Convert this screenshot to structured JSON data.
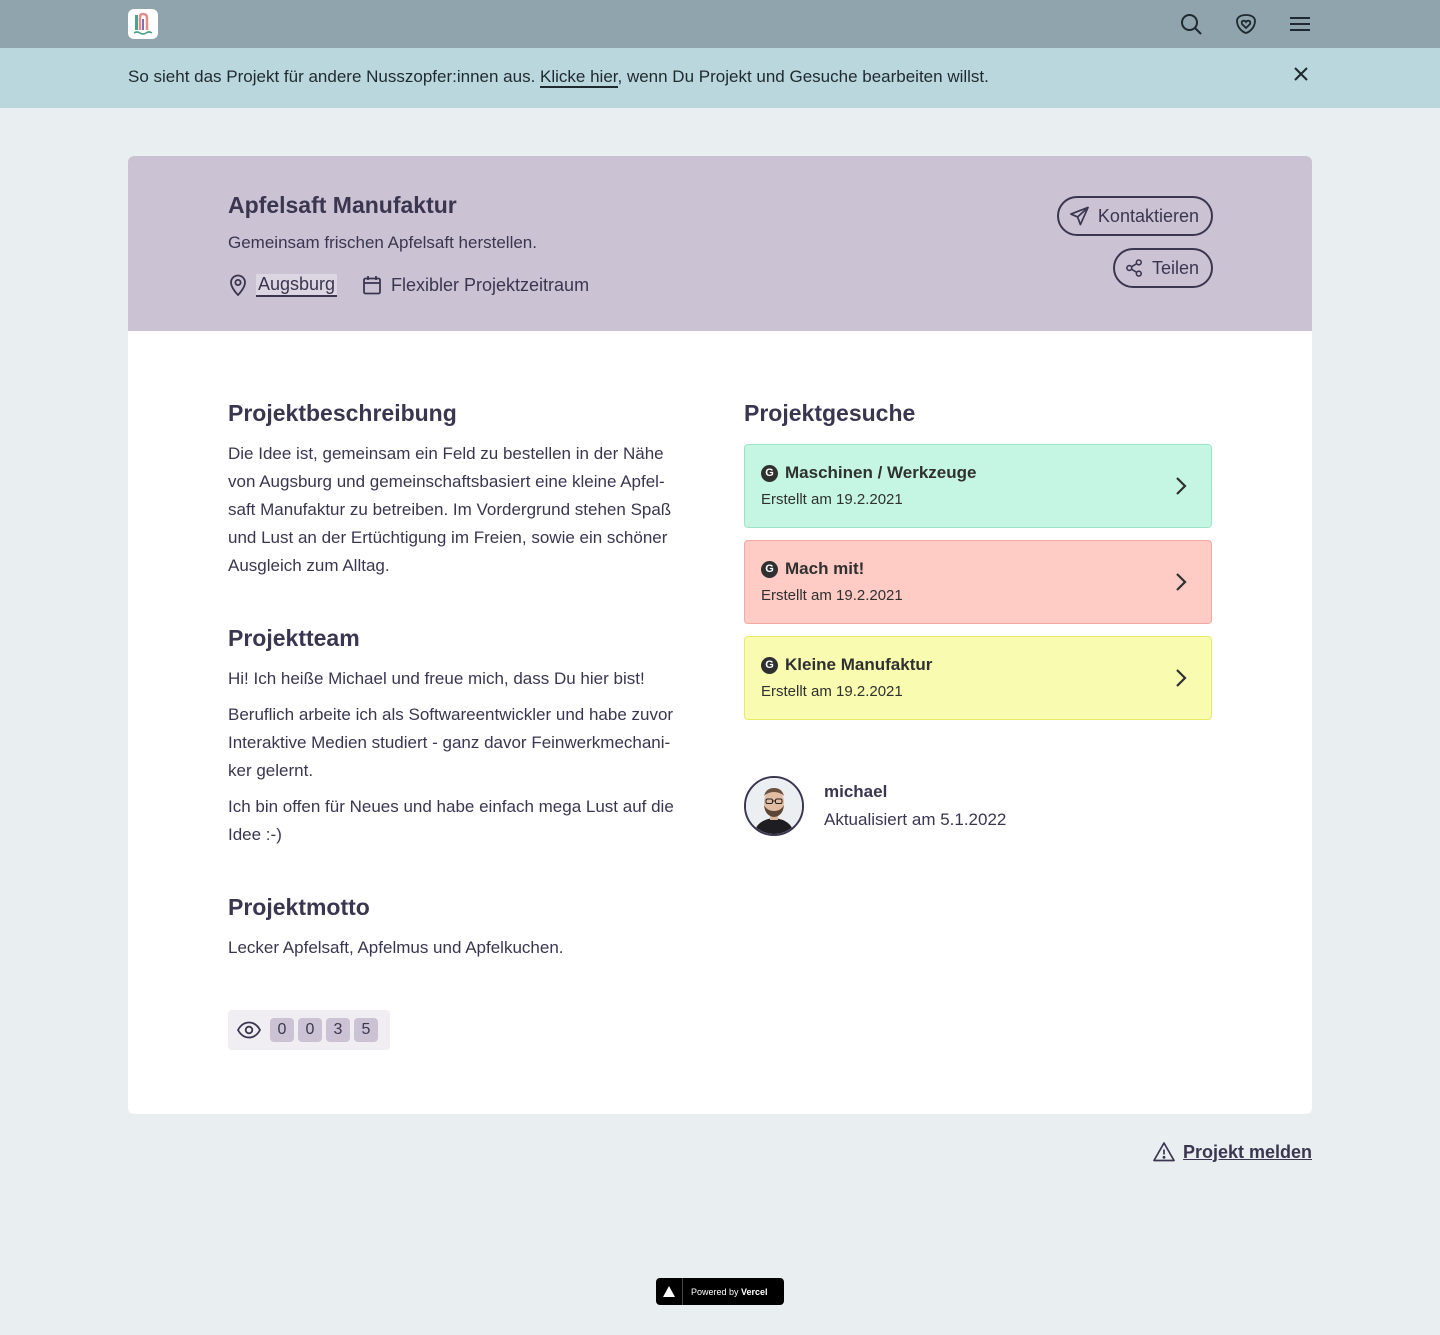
{
  "banner": {
    "text_before": "So sieht das Projekt für andere Nusszopfer:innen aus. ",
    "link": "Klicke hier",
    "text_after": ", wenn Du Projekt und Gesuche bearbeiten willst."
  },
  "project": {
    "title": "Apfelsaft Manufaktur",
    "subtitle": "Gemeinsam frischen Apfelsaft herstellen.",
    "location": "Augsburg",
    "timeframe": "Flexibler Projektzeitraum",
    "contact_label": "Kontaktieren",
    "share_label": "Teilen"
  },
  "description": {
    "heading": "Projektbeschreibung",
    "lines": [
      "Die Idee ist, gemeinsam ein Feld zu bestellen in der Nähe",
      "von Augsburg und gemeinschaftsbasiert eine kleine Apfel-",
      "saft Manufaktur zu betreiben. Im Vordergrund stehen Spaß",
      "und Lust an der Ertüchtigung im Freien, sowie ein schöner",
      "Ausgleich zum Alltag."
    ]
  },
  "team": {
    "heading": "Projektteam",
    "p1": "Hi! Ich heiße Michael und freue mich, dass Du hier bist!",
    "p2_lines": [
      "Beruflich arbeite ich als Softwareentwickler und habe zuvor",
      "Interaktive Medien studiert - ganz davor Feinwerkmechani-",
      "ker gelernt."
    ],
    "p3_lines": [
      "Ich bin offen für Neues und habe einfach mega Lust auf die",
      "Idee :-)"
    ]
  },
  "motto": {
    "heading": "Projektmotto",
    "text": "Lecker Apfelsaft, Apfelmus und Apfelkuchen."
  },
  "views": {
    "digits": [
      "0",
      "0",
      "3",
      "5"
    ]
  },
  "requests": {
    "heading": "Projektgesuche",
    "badge": "G",
    "items": [
      {
        "title": "Maschinen / Werkzeuge",
        "date": "Erstellt am 19.2.2021",
        "color": "#c5f6e3"
      },
      {
        "title": "Mach mit!",
        "date": "Erstellt am 19.2.2021",
        "color": "#ffcbc4"
      },
      {
        "title": "Kleine Manufaktur",
        "date": "Erstellt am 19.2.2021",
        "color": "#f8fbb0"
      }
    ]
  },
  "author": {
    "name": "michael",
    "updated": "Aktualisiert am 5.1.2022"
  },
  "footer": {
    "report_label": "Projekt melden",
    "vercel_prefix": "Powered by ",
    "vercel_brand": "Vercel"
  },
  "icons": {
    "logo": "nusszopf-logo",
    "search": "search-icon",
    "cart": "shield-heart-icon",
    "menu": "menu-icon",
    "close": "close-icon",
    "location": "map-pin-icon",
    "calendar": "calendar-icon",
    "send": "send-icon",
    "share": "share-icon",
    "chevron": "chevron-right-icon",
    "eye": "eye-icon",
    "warning": "warning-icon"
  },
  "colors": {
    "topbar": "#8fa4ac",
    "banner": "#b9d7dc",
    "header": "#cbc3d4",
    "page": "#e9eef1",
    "text": "#3a3650"
  }
}
